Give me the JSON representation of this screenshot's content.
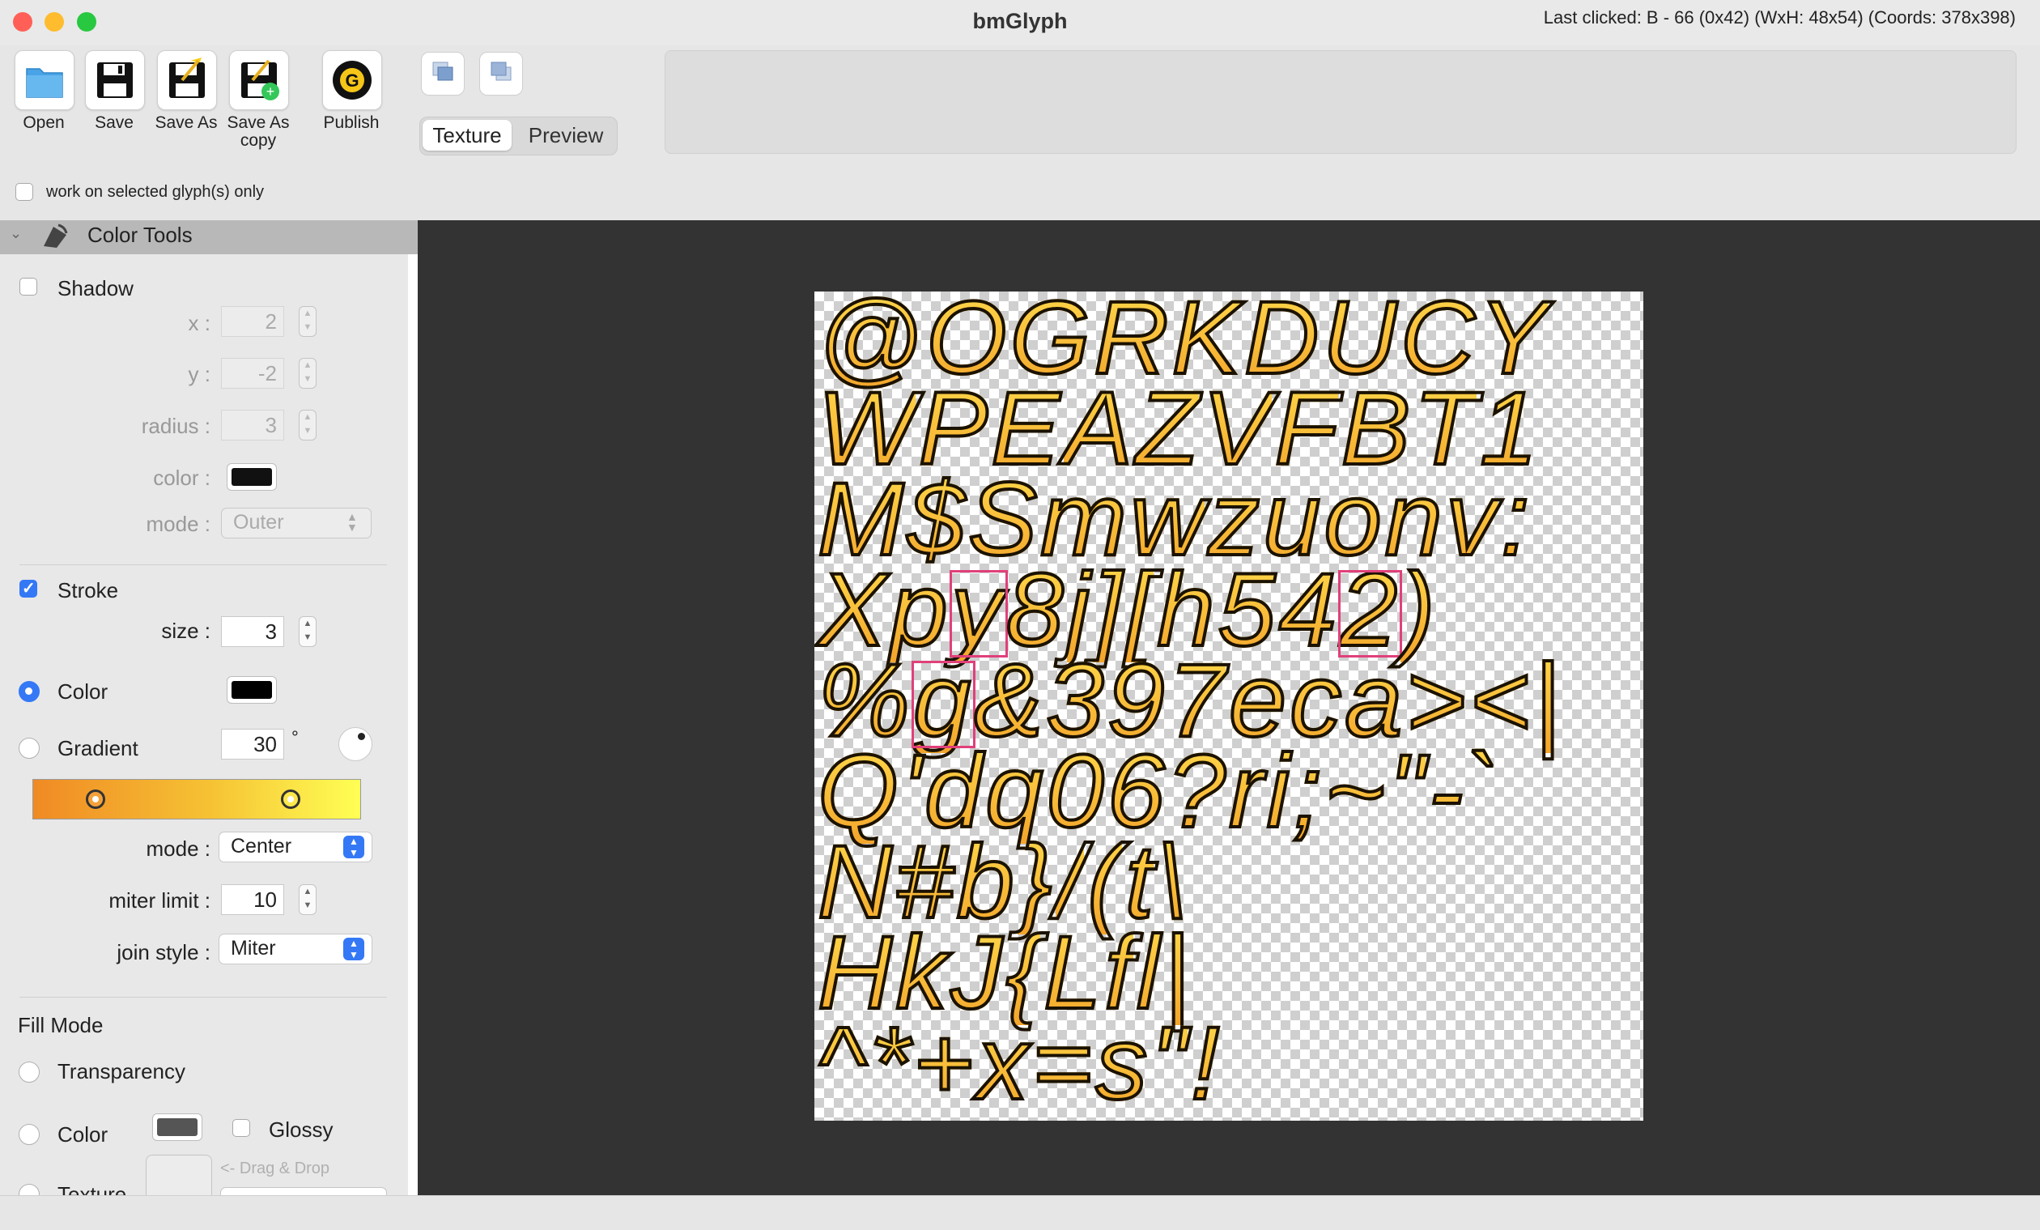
{
  "window": {
    "title": "bmGlyph",
    "traffic_lights": {
      "close": "#ff5f57",
      "minimize": "#febc2e",
      "zoom": "#28c840"
    }
  },
  "toolbar": {
    "open_label": "Open",
    "save_label": "Save",
    "save_as_label": "Save As",
    "save_as_copy_label": "Save As copy",
    "publish_label": "Publish",
    "view_tabs": {
      "texture": "Texture",
      "preview": "Preview",
      "selected": "Texture"
    },
    "work_on_selected_label": "work on selected glyph(s) only",
    "work_on_selected_checked": false
  },
  "sidebar": {
    "section_title": "Color Tools",
    "shadow": {
      "label": "Shadow",
      "checked": false,
      "x_label": "x :",
      "x_value": "2",
      "y_label": "y :",
      "y_value": "-2",
      "radius_label": "radius :",
      "radius_value": "3",
      "color_label": "color :",
      "color_value": "#111111",
      "mode_label": "mode :",
      "mode_value": "Outer"
    },
    "stroke": {
      "label": "Stroke",
      "checked": true,
      "size_label": "size :",
      "size_value": "3",
      "color_option_label": "Color",
      "color_selected": true,
      "color_value": "#000000",
      "gradient_option_label": "Gradient",
      "gradient_angle": "30",
      "degree_symbol": "°",
      "gradient_colors": [
        "#f08a24",
        "#f6c334",
        "#ffff55"
      ],
      "mode_label": "mode :",
      "mode_value": "Center",
      "miter_label": "miter limit :",
      "miter_value": "10",
      "join_label": "join style :",
      "join_value": "Miter"
    },
    "fill_mode": {
      "title": "Fill Mode",
      "transparency_label": "Transparency",
      "color_label": "Color",
      "color_value": "#555555",
      "glossy_label": "Glossy",
      "glossy_checked": false,
      "texture_label": "Texture",
      "drag_drop_label": "<- Drag & Drop"
    }
  },
  "canvas": {
    "glyph_fill": [
      "#ffd84a",
      "#f3a52b"
    ],
    "glyph_stroke": "#1b1200",
    "rows": [
      [
        "@",
        "O",
        "G",
        "R",
        "K",
        "D",
        "U",
        "C",
        "Y"
      ],
      [
        "W",
        "P",
        "E",
        "A",
        "Z",
        "V",
        "F",
        "B",
        "T",
        "1"
      ],
      [
        "M",
        "$",
        "S",
        "m",
        "w",
        "z",
        "u",
        "o",
        "n",
        "v",
        ":"
      ],
      [
        "X",
        "p",
        "y",
        "8",
        "j",
        "]",
        "[",
        "h",
        "5",
        "4",
        "2",
        ")"
      ],
      [
        "%",
        "g",
        "&",
        "3",
        "9",
        "7",
        "e",
        "c",
        "a",
        ">",
        "<",
        "|"
      ],
      [
        "Q",
        "'",
        "d",
        "q",
        "0",
        "6",
        "?",
        "r",
        "i",
        ";",
        "~",
        "\"",
        "-",
        "`"
      ],
      [
        "N",
        "#",
        "b",
        "}",
        "/",
        "(",
        "t",
        "\\"
      ],
      [
        "H",
        "k",
        "J",
        "{",
        "L",
        "f",
        "l",
        "|"
      ],
      [
        "^",
        "*",
        "+",
        "x",
        "=",
        "s",
        "\"",
        "!"
      ]
    ],
    "selected_glyphs": [
      "y",
      "2",
      "g"
    ]
  },
  "status": {
    "text": "Last clicked: B - 66 (0x42) (WxH: 48x54) (Coords: 378x398)"
  }
}
